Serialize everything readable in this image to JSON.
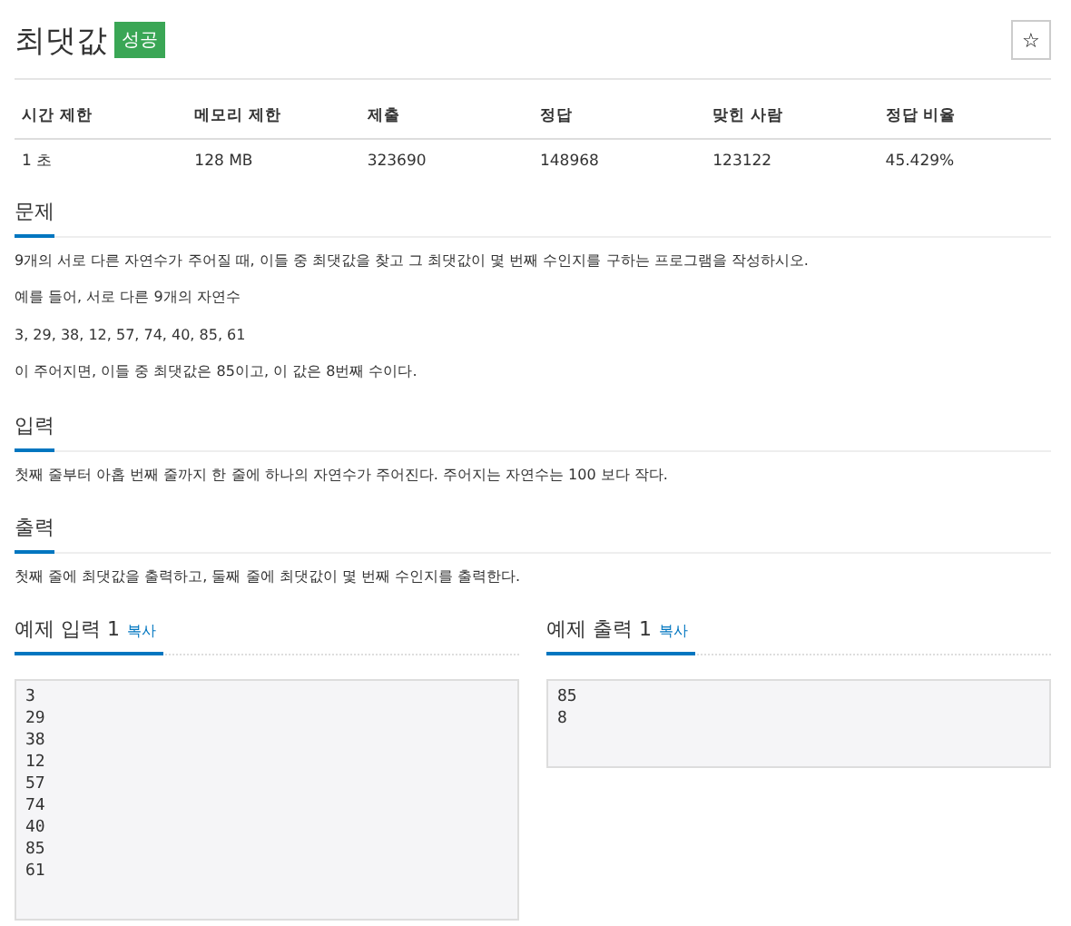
{
  "title": "최댓값",
  "result_badge": "성공",
  "star_button": "☆",
  "info_table": {
    "columns": [
      "시간 제한",
      "메모리 제한",
      "제출",
      "정답",
      "맞힌 사람",
      "정답 비율"
    ],
    "rows": [
      [
        "1 초",
        "128 MB",
        "323690",
        "148968",
        "123122",
        "45.429%"
      ]
    ]
  },
  "sections": [
    {
      "heading": "문제",
      "paragraphs": [
        "9개의 서로 다른 자연수가 주어질 때, 이들 중 최댓값을 찾고 그 최댓값이 몇 번째 수인지를 구하는 프로그램을 작성하시오.",
        "예를 들어, 서로 다른 9개의 자연수",
        "3, 29, 38, 12, 57, 74, 40, 85, 61",
        "이 주어지면, 이들 중 최댓값은 85이고, 이 값은 8번째 수이다."
      ]
    },
    {
      "heading": "입력",
      "paragraphs": [
        "첫째 줄부터 아홉 번째 줄까지 한 줄에 하나의 자연수가 주어진다. 주어지는 자연수는 100 보다 작다."
      ]
    },
    {
      "heading": "출력",
      "paragraphs": [
        "첫째 줄에 최댓값을 출력하고, 둘째 줄에 최댓값이 몇 번째 수인지를 출력한다."
      ]
    }
  ],
  "samples": [
    {
      "heading": "예제 입력 1",
      "copy_link": "복사",
      "lines": [
        "3",
        "29",
        "38",
        "12",
        "57",
        "74",
        "40",
        "85",
        "61"
      ]
    },
    {
      "heading": "예제 출력 1",
      "copy_link": "복사",
      "lines": [
        "85",
        "8"
      ]
    }
  ]
}
